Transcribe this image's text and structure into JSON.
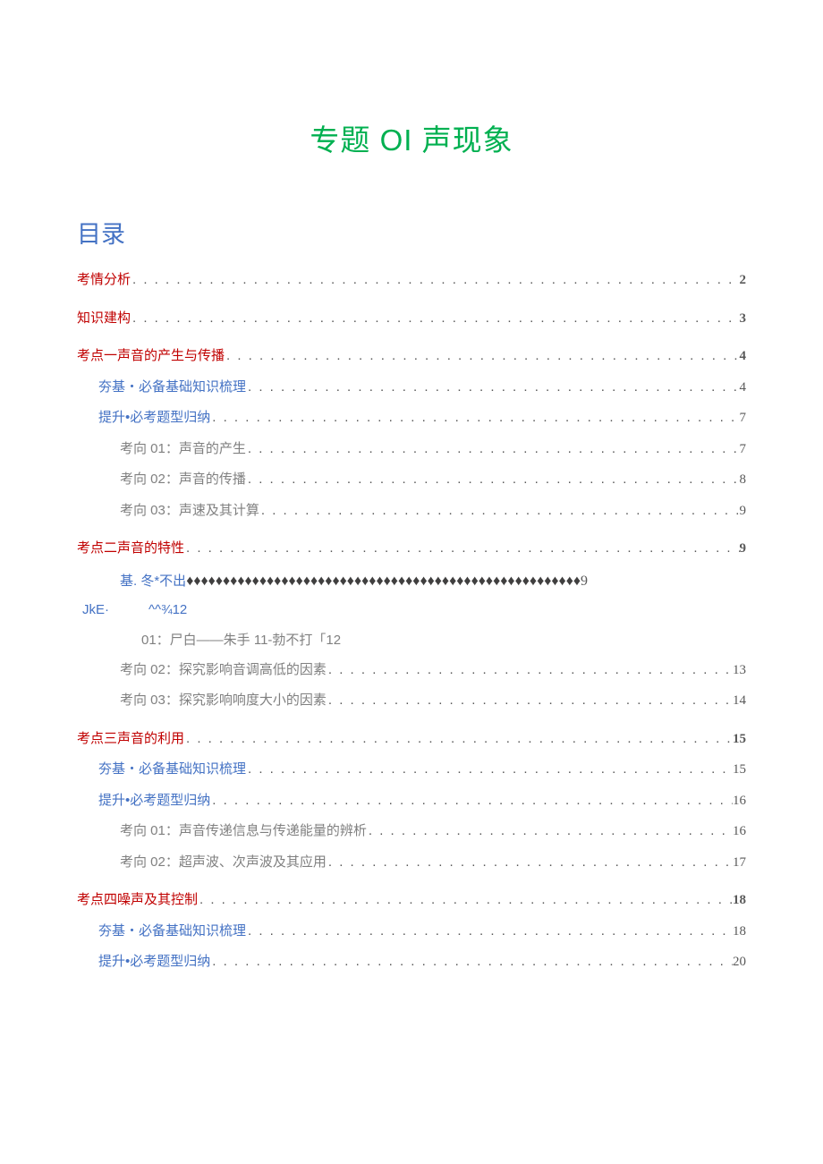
{
  "title": "专题 OI 声现象",
  "toc_header": "目录",
  "dots": ". . . . . . . . . . . . . . . . . . . . . . . . . . . . . . . . . . . . . . . . . . . . . . . . . . . . . . . . . . . . . . . . . . . . . . . . . . . . . . . . . . . . . . . . . . . . . . . . . . . . . . . . . . . . . . . . . . . . . . . . . . . . . . . . . . . . . . . . . . . . . . . . . . . . . . . . . . . . . . . .",
  "diamonds": "♦♦♦♦♦♦♦♦♦♦♦♦♦♦♦♦♦♦♦♦♦♦♦♦♦♦♦♦♦♦♦♦♦♦♦♦♦♦♦♦♦♦♦♦♦♦♦♦♦♦♦♦♦♦",
  "entries": {
    "r1": {
      "label": "考情分析",
      "page": "2"
    },
    "r2": {
      "label": "知识建构",
      "page": "3"
    },
    "r3": {
      "label": "考点一声音的产生与传播",
      "page": "4"
    },
    "r4": {
      "label": "夯基・必备基础知识梳理",
      "page": "4"
    },
    "r5": {
      "label": "提升•必考题型归纳",
      "page": "7"
    },
    "r6": {
      "label": "考向 01：声音的产生",
      "page": "7"
    },
    "r7": {
      "label": "考向 02：声音的传播",
      "page": "8"
    },
    "r8": {
      "label": "考向 03：声速及其计算",
      "page": "9"
    },
    "r9": {
      "label": "考点二声音的特性",
      "page": "9"
    },
    "r10": {
      "label": "基. 冬*不出",
      "page": "9"
    },
    "r11": {
      "label_a": "JkE·",
      "label_b": "^^¾12"
    },
    "r12": {
      "label": "01：尸白——朱手 11-勃不打「12"
    },
    "r13": {
      "label": "考向 02：探究影响音调高低的因素",
      "page": "13"
    },
    "r14": {
      "label": "考向 03：探究影响响度大小的因素",
      "page": "14"
    },
    "r15": {
      "label": "考点三声音的利用",
      "page": "15"
    },
    "r16": {
      "label": "夯基・必备基础知识梳理",
      "page": "15"
    },
    "r17": {
      "label": "提升•必考题型归纳",
      "page": "16"
    },
    "r18": {
      "label": "考向 01：声音传递信息与传递能量的辨析",
      "page": "16"
    },
    "r19": {
      "label": "考向 02：超声波、次声波及其应用",
      "page": "17"
    },
    "r20": {
      "label": "考点四噪声及其控制",
      "page": "18"
    },
    "r21": {
      "label": "夯基・必备基础知识梳理",
      "page": "18"
    },
    "r22": {
      "label": "提升•必考题型归纳",
      "page": "20"
    }
  }
}
